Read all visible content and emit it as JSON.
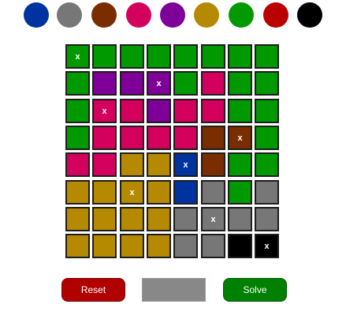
{
  "palette": [
    {
      "name": "blue",
      "color": "#0033a0"
    },
    {
      "name": "gray",
      "color": "#777777"
    },
    {
      "name": "brown",
      "color": "#7a2e00"
    },
    {
      "name": "magenta",
      "color": "#d4005e"
    },
    {
      "name": "purple",
      "color": "#7e0099"
    },
    {
      "name": "gold",
      "color": "#b58a00"
    },
    {
      "name": "green",
      "color": "#009900"
    },
    {
      "name": "red",
      "color": "#bb0000"
    },
    {
      "name": "black",
      "color": "#000000"
    }
  ],
  "board": {
    "rows": [
      [
        "green",
        "green",
        "green",
        "green",
        "green",
        "green",
        "green",
        "green"
      ],
      [
        "green",
        "purple",
        "purple",
        "purple",
        "green",
        "magenta",
        "green",
        "green"
      ],
      [
        "green",
        "magenta",
        "magenta",
        "purple",
        "magenta",
        "magenta",
        "green",
        "green"
      ],
      [
        "green",
        "magenta",
        "magenta",
        "magenta",
        "magenta",
        "brown",
        "brown",
        "green"
      ],
      [
        "magenta",
        "magenta",
        "gold",
        "gold",
        "blue",
        "brown",
        "green",
        "green"
      ],
      [
        "gold",
        "gold",
        "gold",
        "gold",
        "blue",
        "gray",
        "green",
        "gray"
      ],
      [
        "gold",
        "gold",
        "gold",
        "gold",
        "gray",
        "gray",
        "gray",
        "gray"
      ],
      [
        "gold",
        "gold",
        "gold",
        "gold",
        "gray",
        "gray",
        "black",
        "black"
      ]
    ],
    "marks": [
      {
        "row": 0,
        "col": 0,
        "text": "x"
      },
      {
        "row": 1,
        "col": 3,
        "text": "x"
      },
      {
        "row": 2,
        "col": 1,
        "text": "x"
      },
      {
        "row": 3,
        "col": 6,
        "text": "x"
      },
      {
        "row": 4,
        "col": 4,
        "text": "x"
      },
      {
        "row": 5,
        "col": 2,
        "text": "x"
      },
      {
        "row": 6,
        "col": 5,
        "text": "x"
      },
      {
        "row": 7,
        "col": 7,
        "text": "x"
      }
    ]
  },
  "buttons": {
    "reset_label": "Reset",
    "middle_label": "",
    "solve_label": "Solve"
  }
}
